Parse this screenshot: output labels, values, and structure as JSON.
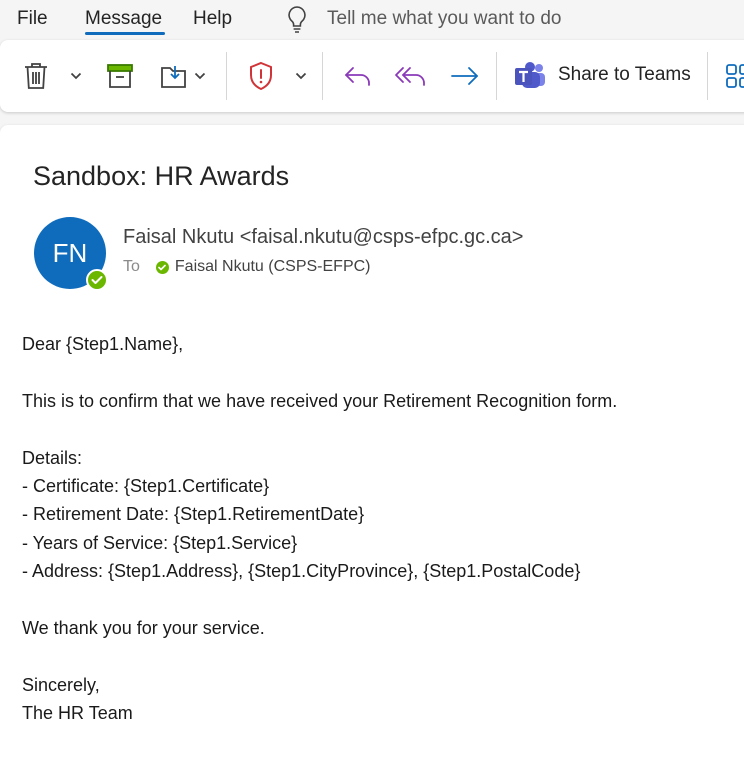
{
  "menu": {
    "file": "File",
    "message": "Message",
    "help": "Help",
    "tell_me": "Tell me what you want to do"
  },
  "ribbon": {
    "share_to_teams": "Share to Teams",
    "icons": [
      "delete-icon",
      "archive-icon",
      "move-icon",
      "report-icon",
      "reply-icon",
      "reply-all-icon",
      "forward-icon",
      "teams-icon",
      "apps-icon"
    ],
    "colors": {
      "reply": "#8a3ab9",
      "forward": "#0f6cbd",
      "report": "#d13438"
    }
  },
  "email": {
    "subject": "Sandbox: HR Awards",
    "avatar_initials": "FN",
    "sender": "Faisal Nkutu <faisal.nkutu@csps-efpc.gc.ca>",
    "to_label": "To",
    "to_name": "Faisal Nkutu  (CSPS-EFPC)",
    "body": {
      "greeting": "Dear {Step1.Name},",
      "confirm": "This is to confirm that we have received your Retirement Recognition form.",
      "details_label": "Details:",
      "details": [
        "- Certificate: {Step1.Certificate}",
        "- Retirement Date: {Step1.RetirementDate}",
        "- Years of Service: {Step1.Service}",
        "- Address: {Step1.Address}, {Step1.CityProvince}, {Step1.PostalCode}"
      ],
      "thanks": "We thank you for your service.",
      "closing": "Sincerely,",
      "signature": "The HR Team"
    },
    "colors": {
      "avatar": "#0f6cbd",
      "presence": "#6bb700"
    }
  }
}
